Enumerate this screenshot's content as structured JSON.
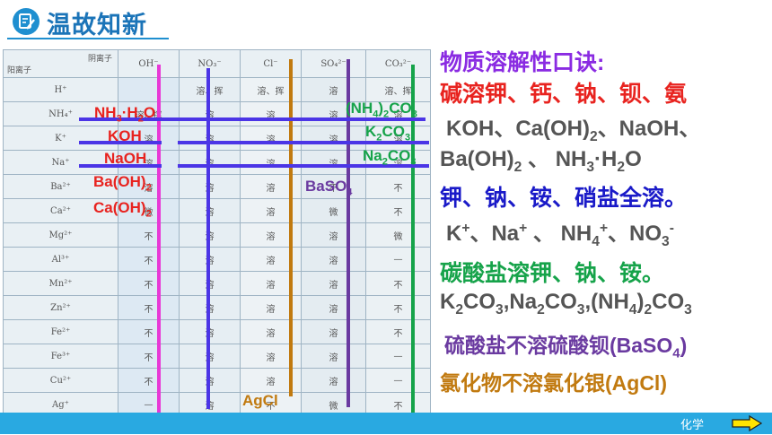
{
  "header": {
    "title": "温故知新",
    "icon": "notebook-pen-icon"
  },
  "table": {
    "corner_anion": "阴离子",
    "corner_cation": "阳离子",
    "anions": [
      "OH⁻",
      "NO₃⁻",
      "Cl⁻",
      "SO₄²⁻",
      "CO₃²⁻"
    ],
    "rows": [
      {
        "cation": "H⁺",
        "cells": [
          "",
          "溶、挥",
          "溶、挥",
          "溶",
          "溶、挥"
        ]
      },
      {
        "cation": "NH₄⁺",
        "cells": [
          "溶、挥",
          "溶",
          "溶",
          "溶",
          "溶"
        ]
      },
      {
        "cation": "K⁺",
        "cells": [
          "溶",
          "溶",
          "溶",
          "溶",
          "溶"
        ]
      },
      {
        "cation": "Na⁺",
        "cells": [
          "溶",
          "溶",
          "溶",
          "溶",
          "溶"
        ]
      },
      {
        "cation": "Ba²⁺",
        "cells": [
          "溶",
          "溶",
          "溶",
          "不",
          "不"
        ]
      },
      {
        "cation": "Ca²⁺",
        "cells": [
          "微",
          "溶",
          "溶",
          "微",
          "不"
        ]
      },
      {
        "cation": "Mg²⁺",
        "cells": [
          "不",
          "溶",
          "溶",
          "溶",
          "微"
        ]
      },
      {
        "cation": "Al³⁺",
        "cells": [
          "不",
          "溶",
          "溶",
          "溶",
          "—"
        ]
      },
      {
        "cation": "Mn²⁺",
        "cells": [
          "不",
          "溶",
          "溶",
          "溶",
          "不"
        ]
      },
      {
        "cation": "Zn²⁺",
        "cells": [
          "不",
          "溶",
          "溶",
          "溶",
          "不"
        ]
      },
      {
        "cation": "Fe²⁺",
        "cells": [
          "不",
          "溶",
          "溶",
          "溶",
          "不"
        ]
      },
      {
        "cation": "Fe³⁺",
        "cells": [
          "不",
          "溶",
          "溶",
          "溶",
          "—"
        ]
      },
      {
        "cation": "Cu²⁺",
        "cells": [
          "不",
          "溶",
          "溶",
          "溶",
          "—"
        ]
      },
      {
        "cation": "Ag⁺",
        "cells": [
          "—",
          "溶",
          "不",
          "微",
          "不"
        ]
      }
    ]
  },
  "overlay_labels": {
    "nh3h2o": {
      "pre": "NH",
      "s1": "3",
      "mid": "·H",
      "s2": "2",
      "post": "O"
    },
    "koh": "KOH",
    "naoh": "NaOH",
    "baoh2": {
      "main": "Ba(OH)",
      "sub": "2"
    },
    "caoh2": {
      "main": "Ca(OH)",
      "sub": "2"
    },
    "nh4co3": {
      "p1": "(NH",
      "s1": "4",
      "p2": ")",
      "s2": "2",
      "p3": "CO",
      "s3": "3"
    },
    "k2co3": {
      "p1": "K",
      "s1": "2",
      "p2": "CO",
      "s2": "3"
    },
    "na2co3": {
      "p1": "Na",
      "s1": "2",
      "p2": "CO",
      "s2": "3"
    },
    "baso4": {
      "p1": "BaSO",
      "s1": "4"
    },
    "agcl": "AgCl"
  },
  "mnemonic": {
    "title": "物质溶解性口诀:",
    "line_alkali": "碱溶钾、钙、钠、钡、氨",
    "formula_alkali": {
      "p1": "KOH、Ca(OH)",
      "s1": "2",
      "p2": "、NaOH、",
      "p3": "Ba(OH)",
      "s2": "2",
      "p4": " 、 NH",
      "s3": "3",
      "p5": "·H",
      "s4": "2",
      "p6": "O"
    },
    "line_salt": "钾、钠、铵、硝盐全溶。",
    "ions": {
      "p1": "K",
      "sup1": "+",
      "p2": "、Na",
      "sup2": "+",
      "p3": " 、 NH",
      "sub3": "4",
      "sup3": "+",
      "p4": "、NO",
      "sub4": "3",
      "sup4": "-"
    },
    "line_carbonate": "碳酸盐溶钾、钠、铵。",
    "carbonates": {
      "a": "K",
      "a1": "2",
      "b": "CO",
      "b1": "3",
      "c": ",Na",
      "c1": "2",
      "d": "CO",
      "d1": "3",
      "e": ",(NH",
      "e1": "4",
      "f": ")",
      "f1": "2",
      "g": "CO",
      "g1": "3"
    },
    "line_sulfate": {
      "text": "硫酸盐不溶硫酸钡(BaSO",
      "sub": "4",
      "end": ")"
    },
    "line_chloride": "氯化物不溶氯化银(AgCl)"
  },
  "footer": {
    "label": "化学",
    "arrow_icon": "next-arrow-icon"
  },
  "colors": {
    "accent": "#29a9e1",
    "red": "#e8231f",
    "blue": "#1a1ac8",
    "green": "#16a34a",
    "purple": "#6a3aa0",
    "brown": "#c17a10",
    "line_blue": "#4b35e6",
    "line_magenta": "#e838d6"
  }
}
